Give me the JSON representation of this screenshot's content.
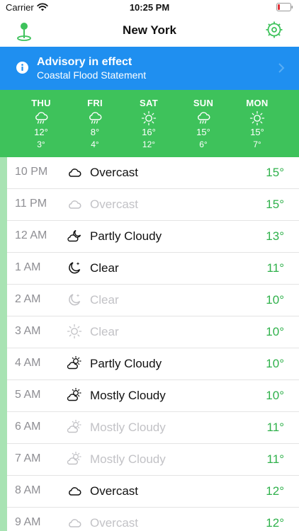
{
  "status_bar": {
    "carrier": "Carrier",
    "time": "10:25 PM",
    "wifi_icon": "wifi-icon",
    "battery_icon": "battery-icon"
  },
  "nav": {
    "title": "New York",
    "left_icon": "location-pin-icon",
    "right_icon": "settings-icon",
    "accent_color": "#3ec25b"
  },
  "advisory": {
    "title": "Advisory in effect",
    "subtitle": "Coastal Flood Statement",
    "icon": "info-icon",
    "background": "#1f8ff0"
  },
  "forecast": {
    "background": "#3ec25b",
    "days": [
      {
        "name": "THU",
        "icon": "rain",
        "high": "12°",
        "low": "3°"
      },
      {
        "name": "FRI",
        "icon": "rain",
        "high": "8°",
        "low": "4°"
      },
      {
        "name": "SAT",
        "icon": "sun",
        "high": "16°",
        "low": "12°"
      },
      {
        "name": "SUN",
        "icon": "rain",
        "high": "15°",
        "low": "6°"
      },
      {
        "name": "MON",
        "icon": "sun",
        "high": "15°",
        "low": "7°"
      }
    ]
  },
  "hourly": {
    "rows": [
      {
        "time": "10 PM",
        "condition": "Overcast",
        "icon": "cloud",
        "temp": "15°",
        "dim": false
      },
      {
        "time": "11 PM",
        "condition": "Overcast",
        "icon": "cloud",
        "temp": "15°",
        "dim": true
      },
      {
        "time": "12 AM",
        "condition": "Partly Cloudy",
        "icon": "moon-cloud",
        "temp": "13°",
        "dim": false
      },
      {
        "time": "1 AM",
        "condition": "Clear",
        "icon": "moon",
        "temp": "11°",
        "dim": false
      },
      {
        "time": "2 AM",
        "condition": "Clear",
        "icon": "moon",
        "temp": "10°",
        "dim": true
      },
      {
        "time": "3 AM",
        "condition": "Clear",
        "icon": "sun",
        "temp": "10°",
        "dim": true
      },
      {
        "time": "4 AM",
        "condition": "Partly Cloudy",
        "icon": "sun-cloud",
        "temp": "10°",
        "dim": false
      },
      {
        "time": "5 AM",
        "condition": "Mostly Cloudy",
        "icon": "sun-cloud",
        "temp": "10°",
        "dim": false
      },
      {
        "time": "6 AM",
        "condition": "Mostly Cloudy",
        "icon": "sun-cloud",
        "temp": "11°",
        "dim": true
      },
      {
        "time": "7 AM",
        "condition": "Mostly Cloudy",
        "icon": "sun-cloud",
        "temp": "11°",
        "dim": true
      },
      {
        "time": "8 AM",
        "condition": "Overcast",
        "icon": "cloud",
        "temp": "12°",
        "dim": false
      },
      {
        "time": "9 AM",
        "condition": "Overcast",
        "icon": "cloud",
        "temp": "12°",
        "dim": true
      }
    ]
  }
}
